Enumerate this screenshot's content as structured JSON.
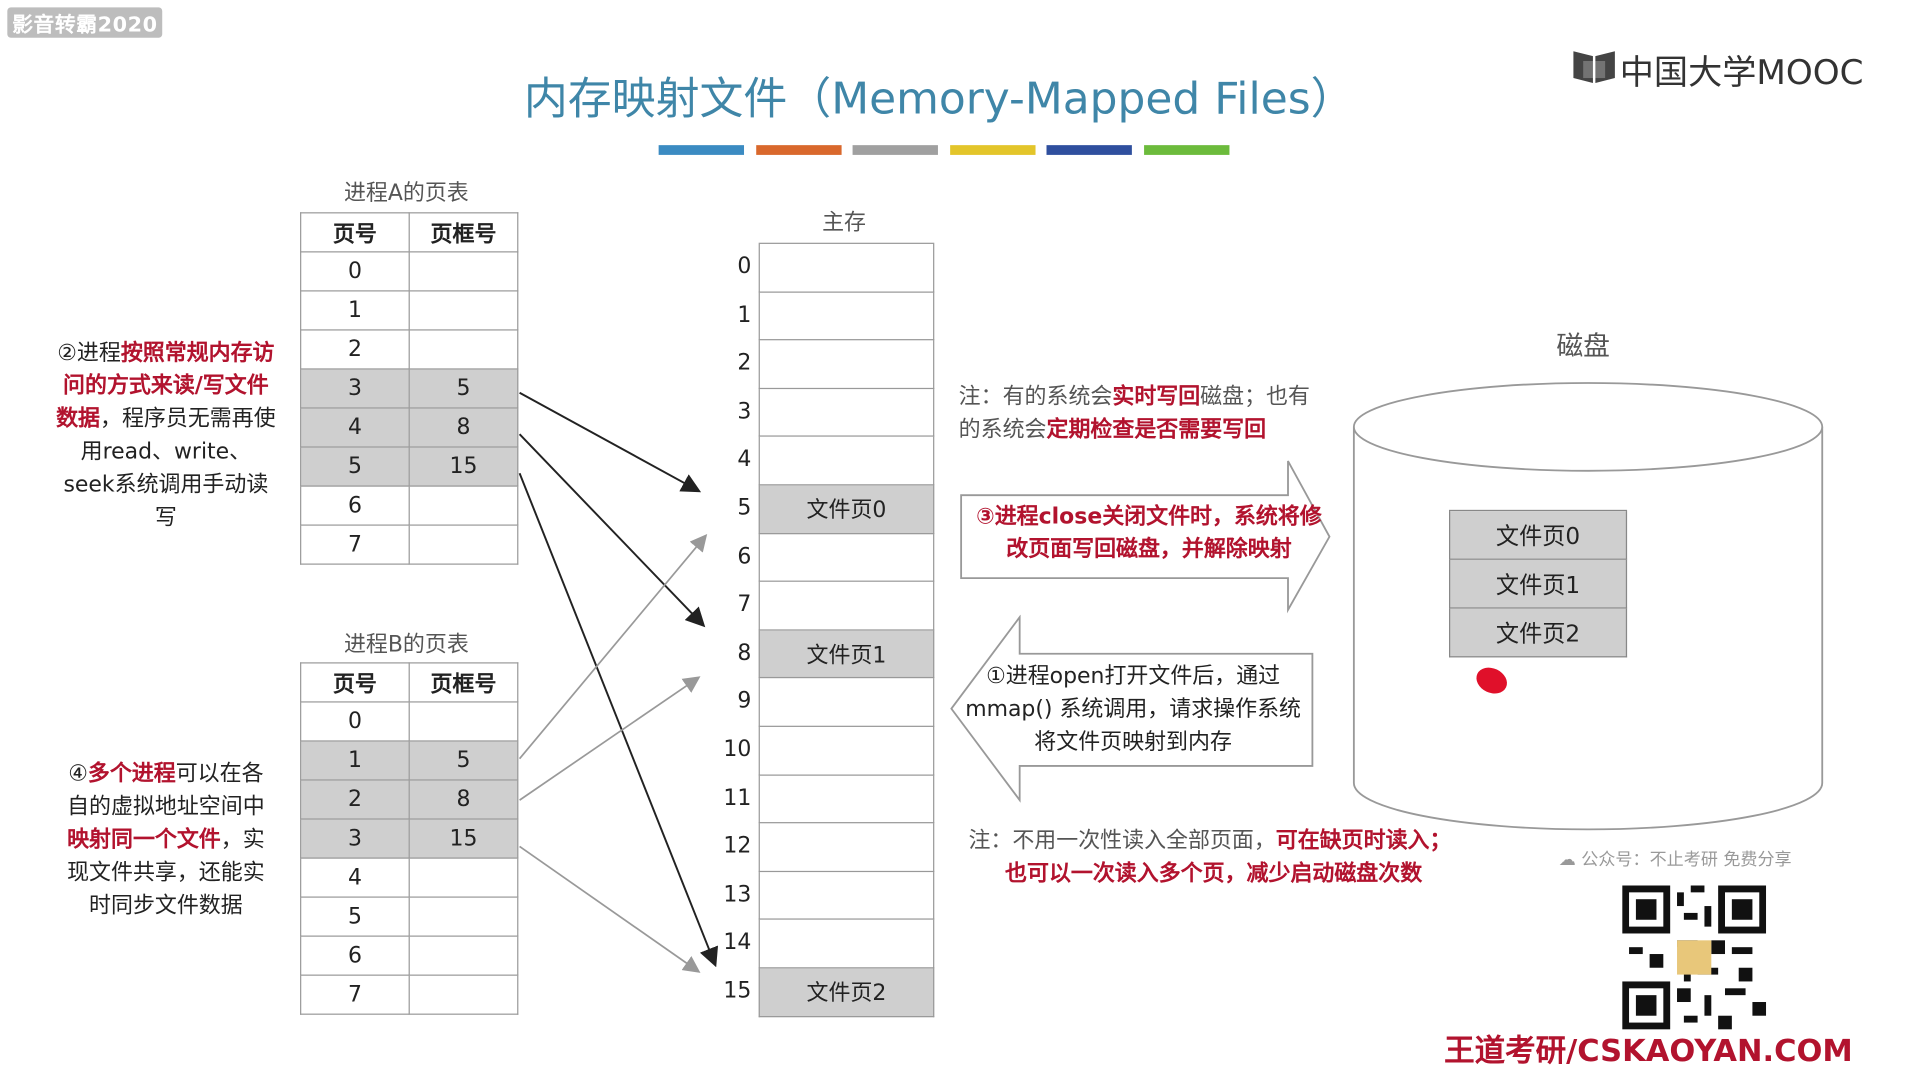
{
  "watermark": "影音转霸2020",
  "title": "内存映射文件（Memory-Mapped Files）",
  "logo": {
    "text": "中国大学MOOC",
    "icon": "mooc-logo-icon"
  },
  "color_bars": [
    "#3b8bc2",
    "#d9682c",
    "#a0a0a0",
    "#e3c52a",
    "#2f4f9e",
    "#6cbb3c"
  ],
  "tableA": {
    "caption": "进程A的页表",
    "headers": [
      "页号",
      "页框号"
    ],
    "rows": [
      [
        "0",
        ""
      ],
      [
        "1",
        ""
      ],
      [
        "2",
        ""
      ],
      [
        "3",
        "5"
      ],
      [
        "4",
        "8"
      ],
      [
        "5",
        "15"
      ],
      [
        "6",
        ""
      ],
      [
        "7",
        ""
      ]
    ],
    "highlight": [
      3,
      4,
      5
    ]
  },
  "tableB": {
    "caption": "进程B的页表",
    "headers": [
      "页号",
      "页框号"
    ],
    "rows": [
      [
        "0",
        ""
      ],
      [
        "1",
        "5"
      ],
      [
        "2",
        "8"
      ],
      [
        "3",
        "15"
      ],
      [
        "4",
        ""
      ],
      [
        "5",
        ""
      ],
      [
        "6",
        ""
      ],
      [
        "7",
        ""
      ]
    ],
    "highlight": [
      1,
      2,
      3
    ]
  },
  "memory": {
    "caption": "主存",
    "indices": [
      "0",
      "1",
      "2",
      "3",
      "4",
      "5",
      "6",
      "7",
      "8",
      "9",
      "10",
      "11",
      "12",
      "13",
      "14",
      "15"
    ],
    "labels": [
      "",
      "",
      "",
      "",
      "",
      "文件页0",
      "",
      "",
      "文件页1",
      "",
      "",
      "",
      "",
      "",
      "",
      "文件页2"
    ]
  },
  "disk": {
    "caption": "磁盘",
    "pages": [
      "文件页0",
      "文件页1",
      "文件页2"
    ]
  },
  "note_left_a": {
    "p1": "②进程",
    "p2": "按照常规内存访问的方式来读/写文件数据",
    "p3": "，程序员无需再使用read、write、seek系统调用手动读写"
  },
  "note_left_b": {
    "p1": "④",
    "p2": "多个进程",
    "p3": "可以在各自的虚拟地址空间中",
    "p4": "映射同一个文件",
    "p5": "，实现文件共享，还能实时同步文件数据"
  },
  "note_top": {
    "a": "注：有的系统会",
    "b": "实时写回",
    "c": "磁盘；也有的系统会",
    "d": "定期检查是否需要写回"
  },
  "arrow_close": {
    "text": "③进程close关闭文件时，系统将修改页面写回磁盘，并解除映射"
  },
  "arrow_open": {
    "text": "①进程open打开文件后，通过mmap() 系统调用，请求操作系统将文件页映射到内存"
  },
  "note_bottom": {
    "a": "注：不用一次性读入全部页面，",
    "b": "可在缺页时读入；",
    "c": "也可以一次读入多个页，减少启动磁盘次数"
  },
  "wechat": "公众号：不止考研  免费分享",
  "site": "王道考研/CSKAOYAN.COM"
}
